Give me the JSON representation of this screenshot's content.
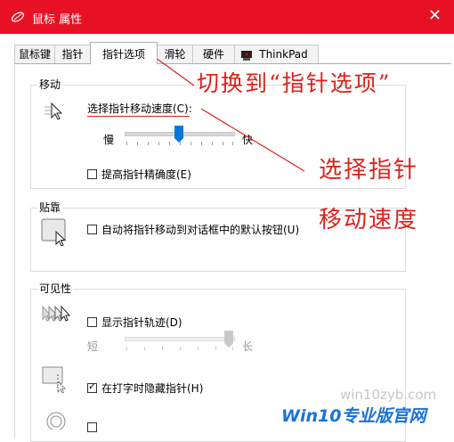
{
  "window": {
    "title": "鼠标 属性",
    "close_icon": "close-icon",
    "accent_color": "#e81123"
  },
  "tabs": [
    {
      "label": "鼠标键"
    },
    {
      "label": "指针"
    },
    {
      "label": "指针选项",
      "active": true
    },
    {
      "label": "滑轮"
    },
    {
      "label": "硬件"
    },
    {
      "label": "ThinkPad"
    }
  ],
  "motion": {
    "group_label": "移动",
    "speed_label": "选择指针移动速度(C):",
    "slow_label": "慢",
    "fast_label": "快",
    "speed_level": 0.5,
    "precision_label": "提高指针精确度(E)",
    "precision_checked": false
  },
  "snap": {
    "group_label": "贴靠",
    "snap_label": "自动将指针移动到对话框中的默认按钮(U)",
    "snap_checked": false
  },
  "visibility": {
    "group_label": "可见性",
    "trail_label": "显示指针轨迹(D)",
    "trail_checked": false,
    "short_label": "短",
    "long_label": "长",
    "trail_level": 1.0,
    "hide_label": "在打字时隐藏指针(H)",
    "hide_checked": true
  },
  "annotations": {
    "switch_tab": "切换到“指针选项”",
    "select_speed_1": "选择指针",
    "select_speed_2": "移动速度",
    "color": "#e0211b"
  },
  "watermark": {
    "site": "win10zyb.com",
    "brand_win10": "Win10",
    "brand_rest": "专业版官网"
  }
}
